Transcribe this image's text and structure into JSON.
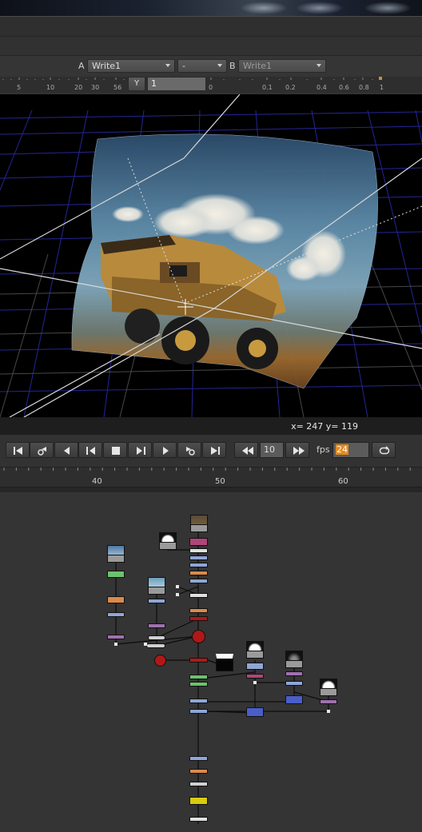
{
  "viewer": {
    "input_a_label": "A",
    "input_a_value": "Write1",
    "compare_mode": "-",
    "input_b_label": "B",
    "input_b_value": "Write1",
    "y_button": "Y",
    "gain_value": "1",
    "fstop_ticks": [
      "5",
      "10",
      "20",
      "30",
      "56"
    ],
    "gamma_ticks": [
      "0",
      "0.1",
      "0.2",
      "0.4",
      "0.6",
      "0.8",
      "1"
    ],
    "cursor_coordinates": "x= 247 y= 119"
  },
  "playback": {
    "buttons": [
      "first-frame",
      "previous-keyframe",
      "play-backward",
      "step-back",
      "stop",
      "step-forward",
      "play-forward",
      "next-keyframe",
      "last-frame"
    ],
    "skip_back_button": "skip-back",
    "frame_increment": "10",
    "skip_forward_button": "skip-forward",
    "fps_label": "fps",
    "fps_value": "24",
    "loop_button": "loop-icon"
  },
  "timeline": {
    "frame_labels": [
      "40",
      "50",
      "60"
    ]
  },
  "colors": {
    "accent_orange": "#e48a1c",
    "node_pink": "#b0457a",
    "node_green": "#6cc26c",
    "node_orange": "#d98a4a",
    "node_blue": "#8fa6d6",
    "node_purple": "#a070b0",
    "node_red": "#b01818",
    "node_dark_blue": "#4a5ec8",
    "node_yellow": "#d8cc10",
    "grid_blue": "#2a2aa8"
  }
}
